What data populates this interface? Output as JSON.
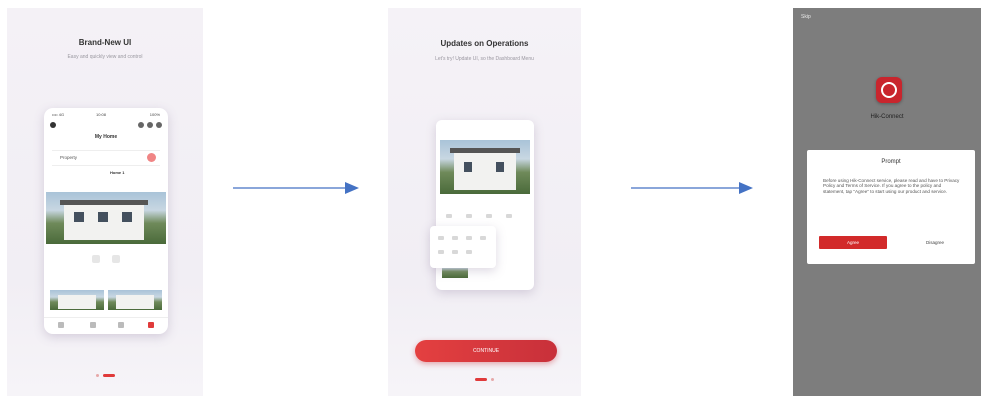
{
  "screens": [
    {
      "title": "Brand-New UI",
      "subtitle": "Easy and quickly view and control",
      "phone": {
        "status_left": "•••• 4G",
        "status_center": "10:08",
        "status_right": "100%",
        "my_home": "My Home",
        "search_label": "Property",
        "home_label": "Home 1"
      }
    },
    {
      "title": "Updates on Operations",
      "subtitle": "Let's try! Update UI, so the Dashboard Menu",
      "button_label": "CONTINUE"
    },
    {
      "corner_label": "Skip",
      "app_name": "Hik-Connect",
      "dialog": {
        "title": "Prompt",
        "body": "Before using Hik-Connect service, please read and have to Privacy Policy and Terms of Service. If you agree to the policy and statement, tap \"Agree\" to start using our product and service.",
        "agree": "Agree",
        "disagree": "Disagree"
      }
    }
  ],
  "colors": {
    "accent": "#d22a2a",
    "arrow": "#4472c4"
  }
}
